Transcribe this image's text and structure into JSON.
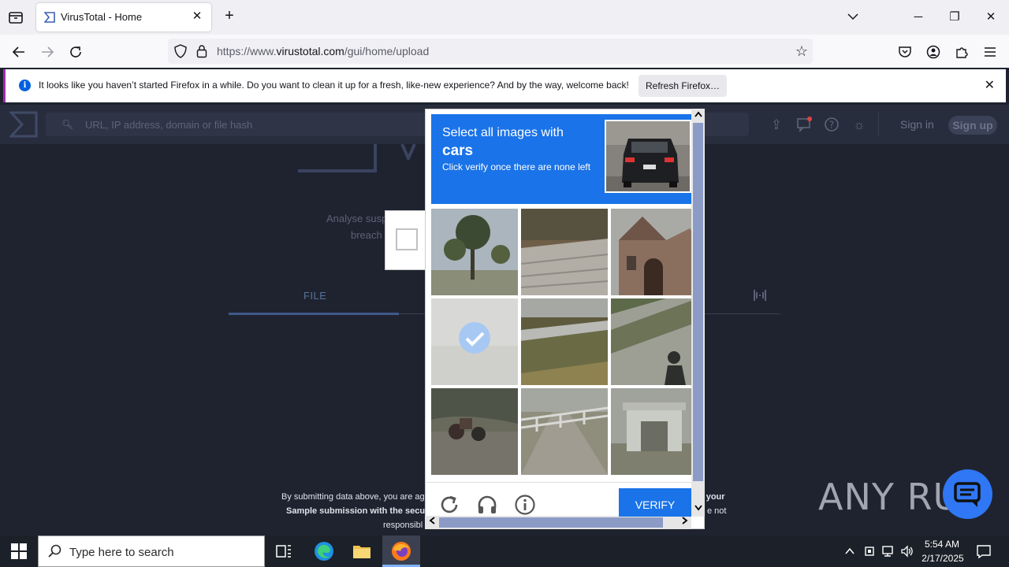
{
  "browser": {
    "tab_title": "VirusTotal - Home",
    "url_prefix": "https://www.",
    "url_domain": "virustotal.com",
    "url_path": "/gui/home/upload",
    "notification": "It looks like you haven’t started Firefox in a while. Do you want to clean it up for a fresh, like-new experience? And by the way, welcome back!",
    "refresh_button": "Refresh Firefox…"
  },
  "virustotal": {
    "search_placeholder": "URL, IP address, domain or file hash",
    "sign_in": "Sign in",
    "sign_up": "Sign up",
    "analyse_text": "Analyse susp",
    "breach_text": "breach",
    "tab_file": "FILE",
    "footer_line1": "By submitting data above, you are ag",
    "footer_line2": "Sample submission with the secur",
    "footer_line3": "responsibl",
    "footer_right1": "f your",
    "footer_right2": "e not"
  },
  "captcha": {
    "instruction": "Select all images with",
    "target": "cars",
    "hint": "Click verify once there are none left",
    "verify_label": "VERIFY",
    "tiles": [
      {
        "name": "palm-trees",
        "selected": false
      },
      {
        "name": "roof",
        "selected": false
      },
      {
        "name": "brick-house",
        "selected": false
      },
      {
        "name": "faded-tile",
        "selected": true
      },
      {
        "name": "highway-guardrail",
        "selected": false
      },
      {
        "name": "road-shadow",
        "selected": false
      },
      {
        "name": "motorcycle",
        "selected": false
      },
      {
        "name": "path-fence",
        "selected": false
      },
      {
        "name": "ruined-structure",
        "selected": false
      }
    ]
  },
  "watermark": "ANY RUN",
  "taskbar": {
    "search_placeholder": "Type here to search",
    "time": "5:54 AM",
    "date": "2/17/2025"
  },
  "colors": {
    "captcha_blue": "#1a73e8",
    "vt_bg": "#1f2330",
    "firefox_accent": "#a52ab5"
  }
}
